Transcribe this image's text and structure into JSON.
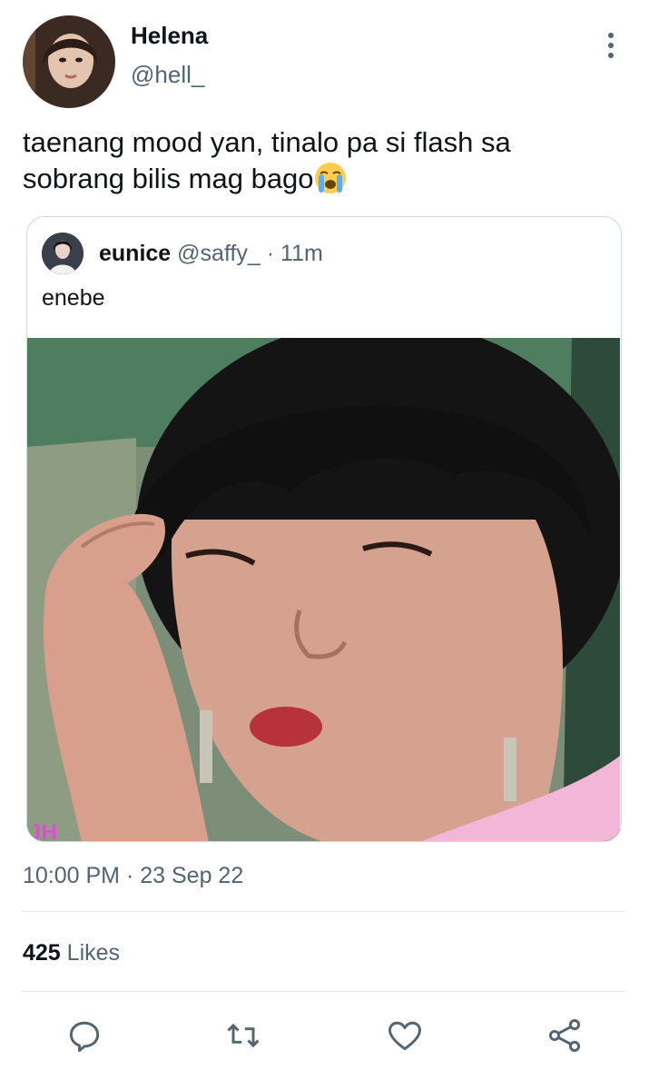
{
  "author": {
    "name": "Helena",
    "handle": "@hell_"
  },
  "tweet": {
    "text": "taenang mood yan, tinalo pa si flash sa sobrang bilis mag bago",
    "emoji": "loudly-crying-face"
  },
  "quoted": {
    "name": "eunice",
    "handle": "@saffy_",
    "meta": "· 11m",
    "text": "enebe",
    "media_watermark": "JH"
  },
  "meta": {
    "time": "10:00 PM",
    "separator": "·",
    "date": "23 Sep 22"
  },
  "stats": {
    "likes_count": "425",
    "likes_label": "Likes"
  },
  "actions": [
    {
      "name": "reply",
      "icon": "reply-icon"
    },
    {
      "name": "retweet",
      "icon": "retweet-icon"
    },
    {
      "name": "like",
      "icon": "heart-icon"
    },
    {
      "name": "share",
      "icon": "share-icon"
    }
  ],
  "colors": {
    "text": "#0f1419",
    "secondary": "#536471",
    "border": "#cfd9de",
    "icon": "#536471"
  }
}
